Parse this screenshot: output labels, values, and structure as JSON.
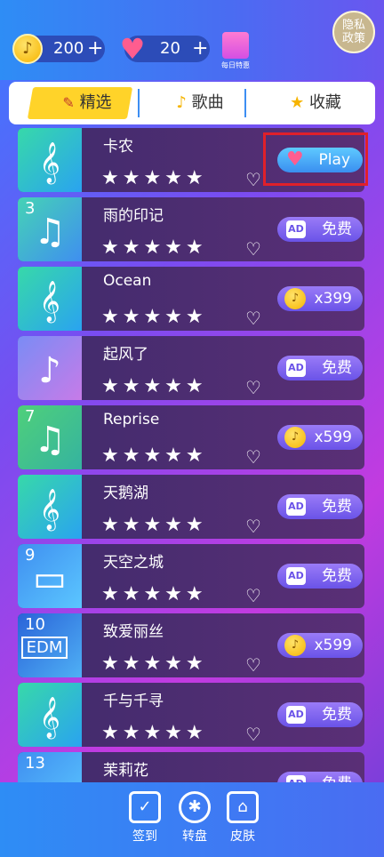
{
  "header": {
    "coins": "200",
    "hearts": "20",
    "gift_label": "每日特惠",
    "privacy_line1": "隐私",
    "privacy_line2": "政策"
  },
  "tabs": [
    {
      "label": "精选",
      "icon": "tag-icon",
      "active": true
    },
    {
      "label": "歌曲",
      "icon": "note-icon",
      "active": false
    },
    {
      "label": "收藏",
      "icon": "star-icon",
      "active": false
    }
  ],
  "songs": [
    {
      "name": "卡农",
      "rank": "",
      "action": "Play",
      "action_type": "play"
    },
    {
      "name": "雨的印记",
      "rank": "3",
      "action": "免费",
      "action_type": "ad"
    },
    {
      "name": "Ocean",
      "rank": "",
      "action": "x399",
      "action_type": "coin"
    },
    {
      "name": "起风了",
      "rank": "",
      "action": "免费",
      "action_type": "ad"
    },
    {
      "name": "Reprise",
      "rank": "7",
      "action": "x599",
      "action_type": "coin"
    },
    {
      "name": "天鹅湖",
      "rank": "",
      "action": "免费",
      "action_type": "ad"
    },
    {
      "name": "天空之城",
      "rank": "9",
      "action": "免费",
      "action_type": "ad"
    },
    {
      "name": "致爱丽丝",
      "rank": "10",
      "action": "x599",
      "action_type": "coin"
    },
    {
      "name": "千与千寻",
      "rank": "",
      "action": "免费",
      "action_type": "ad"
    },
    {
      "name": "茉莉花",
      "rank": "13",
      "action": "免费",
      "action_type": "ad"
    }
  ],
  "thumb_text_edm": "EDM",
  "ad_badge": "AD",
  "bottom_nav": [
    {
      "label": "签到",
      "icon": "calendar-check-icon"
    },
    {
      "label": "转盘",
      "icon": "wheel-icon"
    },
    {
      "label": "皮肤",
      "icon": "shop-icon"
    }
  ],
  "colors": {
    "tab_active": "#ffd329",
    "play_button": "#3a8ff0",
    "action_button": "#6a53e8",
    "highlight": "#e0202a"
  }
}
